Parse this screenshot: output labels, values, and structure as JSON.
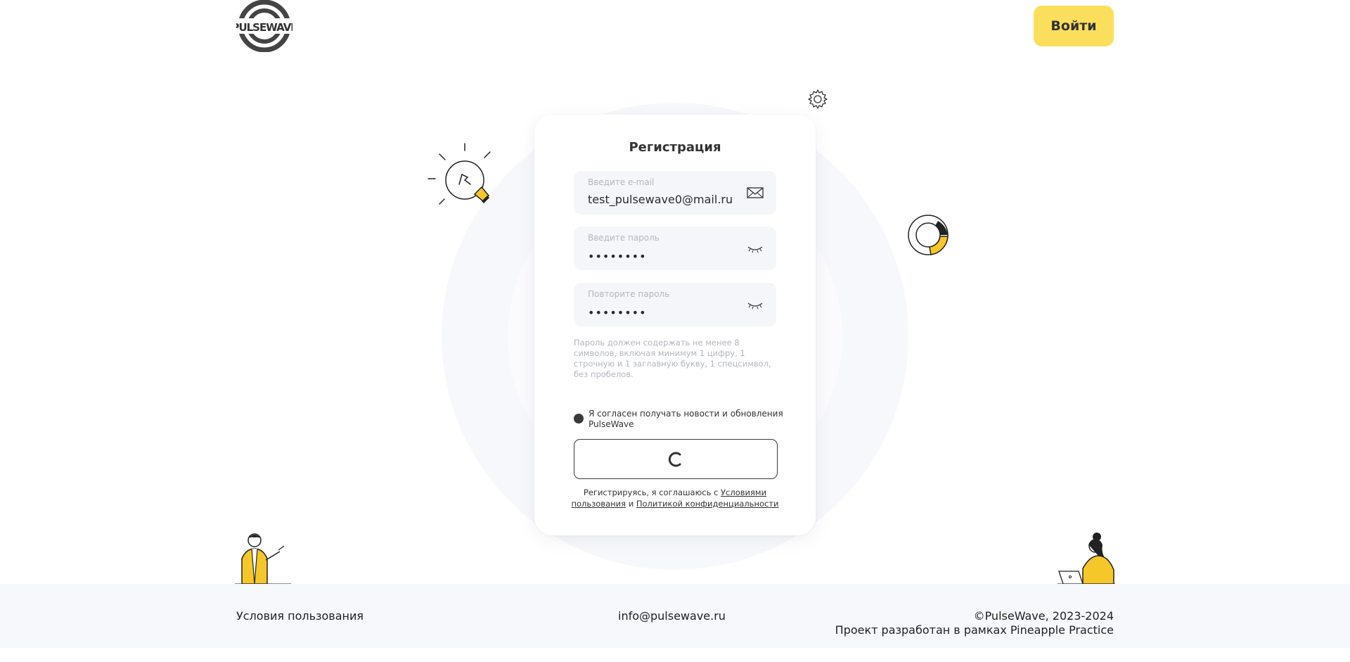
{
  "header": {
    "logo_text": "PULSEWAVE",
    "login_label": "Войти"
  },
  "form": {
    "title": "Регистрация",
    "email": {
      "label": "Введите e-mail",
      "value": "test_pulsewave0@mail.ru",
      "icon": "envelope-icon"
    },
    "password": {
      "label": "Введите пароль",
      "value": "••••••••",
      "icon": "eye-closed-icon"
    },
    "password_repeat": {
      "label": "Повторите пароль",
      "value": "••••••••",
      "icon": "eye-closed-icon"
    },
    "hint": "Пароль должен содержать не менее 8 символов, включая минимум 1 цифру, 1 строчную и 1 заглавную букву, 1 спецсимвол, без пробелов.",
    "consent": "Я согласен получать новости и обновления PulseWave",
    "terms_prefix": "Регистрируясь, я соглашаюсь с",
    "terms_link": "Условиями пользования",
    "terms_and": "и",
    "privacy_link": "Политикой конфиденциальности"
  },
  "footer": {
    "terms": "Условия пользования",
    "email": "info@pulsewave.ru",
    "copyright": "©PulseWave, 2023-2024",
    "project": "Проект разработан в рамках Pineapple Practice"
  },
  "colors": {
    "accent": "#fbdf5c",
    "background_circle": "#f7f8fc",
    "field_bg": "#f5f6fa",
    "text": "#2b2b2b",
    "muted": "#b3b6be"
  }
}
